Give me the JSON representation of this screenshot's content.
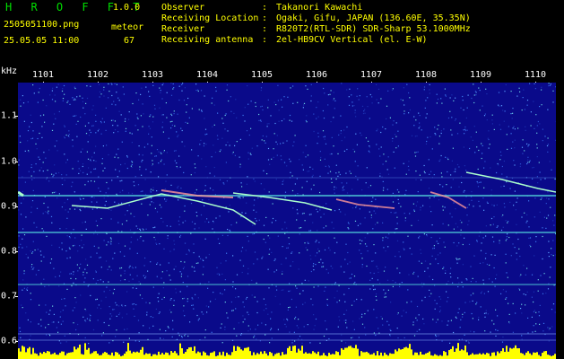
{
  "header": {
    "app_name": "H R O F F T",
    "app_version": "1.0.0",
    "filename": "2505051100.png",
    "datetime": "25.05.05 11:00",
    "count_label": "meteor",
    "count_value": "67",
    "meta": [
      {
        "key": "Observer",
        "value": "Takanori Kawachi"
      },
      {
        "key": "Receiving Location",
        "value": "Ogaki, Gifu, JAPAN (136.60E, 35.35N)"
      },
      {
        "key": "Receiver",
        "value": "R820T2(RTL-SDR) SDR-Sharp 53.1000MHz"
      },
      {
        "key": "Receiving antenna",
        "value": "2el-HB9CV Vertical (el. E-W)"
      }
    ]
  },
  "axes": {
    "unit": "kHz",
    "x_ticks": [
      "1101",
      "1102",
      "1103",
      "1104",
      "1105",
      "1106",
      "1107",
      "1108",
      "1109",
      "1110"
    ],
    "y_ticks": [
      "1.1",
      "1.0",
      "0.9",
      "0.8",
      "0.7",
      "0.6"
    ]
  },
  "colors": {
    "title": "#00e000",
    "version": "#ffff00",
    "filename": "#ffff00",
    "meta": "#ffff00",
    "count": "#ffff00",
    "axis": "#ffffff",
    "background": "#0a0a8a",
    "signal_line": "#55dddd",
    "meteor": "#aaffcc",
    "activity": "#ffff00"
  }
}
